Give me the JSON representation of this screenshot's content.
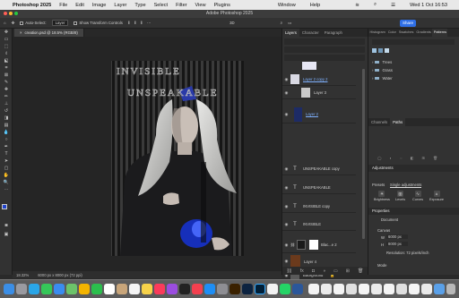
{
  "menubar": {
    "apple": "",
    "app": "Photoshop 2025",
    "items": [
      "File",
      "Edit",
      "Image",
      "Layer",
      "Type",
      "Select",
      "Filter",
      "View",
      "Plugins"
    ],
    "right": [
      "Window",
      "Help"
    ],
    "clock": "Wed 1 Oct 16:53"
  },
  "window_title": "Adobe Photoshop 2025",
  "options": {
    "auto_select": "Auto-Select:",
    "auto_select_target": "Layer",
    "transform_controls": "Show Transform Controls",
    "share": "Share"
  },
  "document": {
    "tab": "creation.psd @ 18.5% (RGB/8)",
    "zoom": "18.32%",
    "info": "6000 px x 8000 px (72 ppi)"
  },
  "canvas": {
    "text1": "INVISIBLE",
    "text2": "UNSPEAKABLE"
  },
  "layers_panel": {
    "tabs": [
      "Layers",
      "Character",
      "Paragraph"
    ],
    "layers": [
      {
        "name": "Layer 2 copy 2",
        "kind": "image",
        "selected": false
      },
      {
        "name": "Layer 3",
        "kind": "image",
        "selected": false
      },
      {
        "name": "Layer 2",
        "kind": "image",
        "selected": false
      },
      {
        "name": "UNSPEAKABLE copy",
        "kind": "text",
        "selected": false
      },
      {
        "name": "UNSPEAKABLE",
        "kind": "text",
        "selected": false
      },
      {
        "name": "INVISIBLE copy",
        "kind": "text",
        "selected": false
      },
      {
        "name": "INVISIBLE",
        "kind": "text",
        "selected": false
      },
      {
        "name": "Blac...e 2",
        "kind": "adjustment",
        "selected": false
      },
      {
        "name": "Layer 4",
        "kind": "image",
        "selected": false
      },
      {
        "name": "Background",
        "kind": "image",
        "selected": false
      }
    ],
    "footer_icons": [
      "link-icon",
      "fx-icon",
      "mask-icon",
      "adjustment-icon",
      "folder-icon",
      "new-layer-icon",
      "trash-icon"
    ]
  },
  "swatches_panel": {
    "tabs": [
      "Histogram",
      "Color",
      "Swatches",
      "Gradients",
      "Patterns"
    ],
    "active": "Patterns",
    "folders": [
      "Trees",
      "Grass",
      "Water"
    ]
  },
  "channels_panel": {
    "tabs": [
      "Channels",
      "Paths"
    ]
  },
  "adjustments_panel": {
    "title": "Adjustments",
    "presets_label": "Presets",
    "single_label": "Single adjustments",
    "buttons": [
      "Brightness",
      "Levels",
      "Curves",
      "Exposure"
    ]
  },
  "properties_panel": {
    "title": "Properties",
    "doc_label": "Document",
    "canvas_label": "Canvas",
    "w_label": "W",
    "w_value": "6000 px",
    "h_label": "H",
    "h_value": "8000 px",
    "resolution": "Resolution: 72 pixels/inch",
    "mode_label": "Mode"
  },
  "colors": {
    "accent": "#2f6fe6",
    "panel": "#323232",
    "menubar": "#e8e8e8"
  }
}
